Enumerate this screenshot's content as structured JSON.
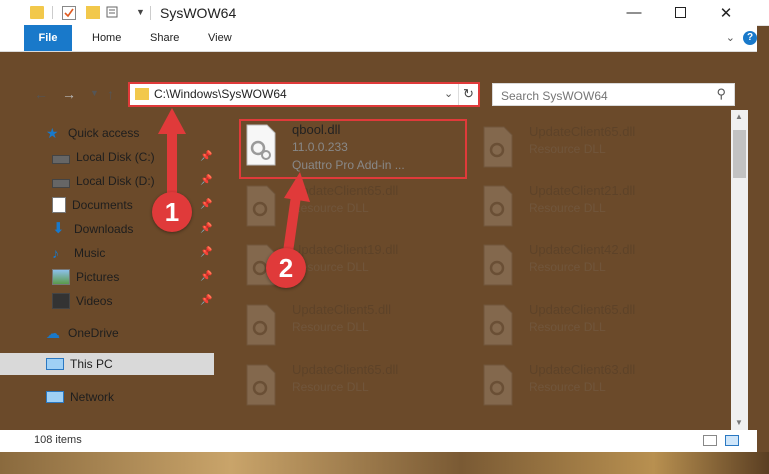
{
  "window": {
    "title": "SysWOW64"
  },
  "ribbon": {
    "tabs": [
      "File",
      "Home",
      "Share",
      "View"
    ]
  },
  "address": {
    "path": "C:\\Windows\\SysWOW64"
  },
  "search": {
    "placeholder": "Search SysWOW64"
  },
  "sidebar": {
    "quick_access": "Quick access",
    "items": [
      {
        "label": "Local Disk (C:)",
        "icon": "drive-icon"
      },
      {
        "label": "Local Disk (D:)",
        "icon": "drive-icon"
      },
      {
        "label": "Documents",
        "icon": "documents-icon"
      },
      {
        "label": "Downloads",
        "icon": "downloads-icon"
      },
      {
        "label": "Music",
        "icon": "music-icon"
      },
      {
        "label": "Pictures",
        "icon": "pictures-icon"
      },
      {
        "label": "Videos",
        "icon": "videos-icon"
      }
    ],
    "onedrive": "OneDrive",
    "this_pc": "This PC",
    "network": "Network"
  },
  "files": {
    "highlighted": {
      "name": "qbool.dll",
      "version": "11.0.0.233",
      "description": "Quattro Pro Add-in ..."
    },
    "left_column": [
      {
        "name": "UpdateClient65.dll",
        "type": "Resource DLL"
      },
      {
        "name": "UpdateClient19.dll",
        "type": "Resource DLL"
      },
      {
        "name": "UpdateClient5.dll",
        "type": "Resource DLL"
      },
      {
        "name": "UpdateClient65.dll",
        "type": "Resource DLL"
      },
      {
        "name": "UpdateClient65.dll",
        "type": "Resource DLL"
      }
    ],
    "right_column": [
      {
        "name": "UpdateClient65.dll",
        "type": "Resource DLL"
      },
      {
        "name": "UpdateClient21.dll",
        "type": "Resource DLL"
      },
      {
        "name": "UpdateClient42.dll",
        "type": "Resource DLL"
      },
      {
        "name": "UpdateClient65.dll",
        "type": "Resource DLL"
      },
      {
        "name": "UpdateClient63.dll",
        "type": "Resource DLL"
      }
    ]
  },
  "status": {
    "items": "108 items"
  },
  "callouts": [
    "1",
    "2"
  ],
  "colors": {
    "accent": "#1979ca",
    "highlight": "#e03a3a"
  }
}
